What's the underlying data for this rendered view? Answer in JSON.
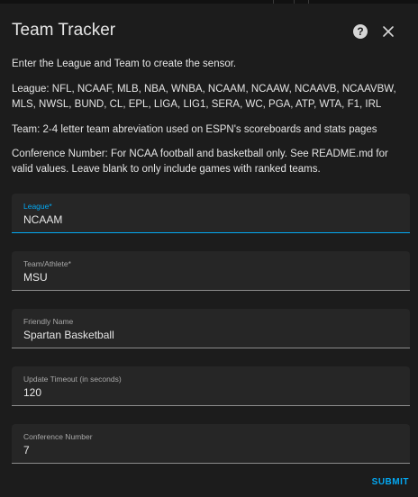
{
  "dialog": {
    "title": "Team Tracker",
    "help_icon_glyph": "?",
    "close_icon": "close-icon"
  },
  "descriptions": [
    "Enter the League and Team to create the sensor.",
    "League: NFL, NCAAF, MLB, NBA, WNBA, NCAAM, NCAAW, NCAAVB, NCAAVBW, MLS, NWSL, BUND, CL, EPL, LIGA, LIG1, SERA, WC, PGA, ATP, WTA, F1, IRL",
    "Team: 2-4 letter team abreviation used on ESPN's scoreboards and stats pages",
    "Conference Number: For NCAA football and basketball only. See README.md for valid values. Leave blank to only include games with ranked teams."
  ],
  "fields": {
    "league": {
      "label": "League*",
      "value": "NCAAM"
    },
    "team": {
      "label": "Team/Athlete*",
      "value": "MSU"
    },
    "friendly_name": {
      "label": "Friendly Name",
      "value": "Spartan Basketball"
    },
    "timeout": {
      "label": "Update Timeout (in seconds)",
      "value": "120"
    },
    "conference": {
      "label": "Conference Number",
      "value": "7"
    }
  },
  "actions": {
    "submit_label": "SUBMIT"
  },
  "colors": {
    "accent": "#03a9f4",
    "background": "#1c1c1c",
    "field_background": "#262626"
  }
}
